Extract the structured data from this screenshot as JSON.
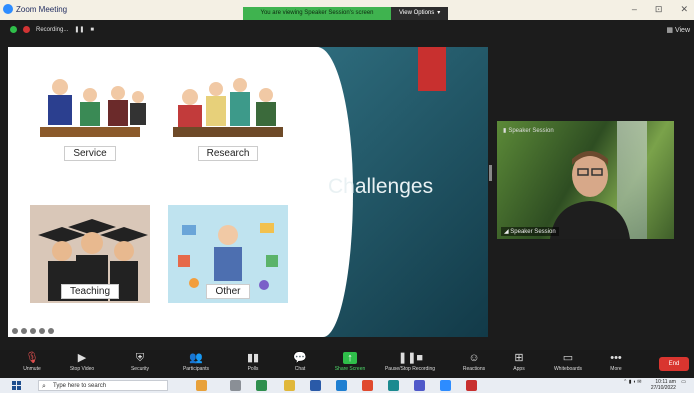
{
  "titlebar": {
    "app_name": "Zoom Meeting"
  },
  "share_banner": {
    "message": "You are viewing Speaker Session's screen",
    "options_label": "View Options"
  },
  "window_controls": {
    "minimize": "–",
    "maximize": "⊡",
    "close": "✕"
  },
  "meeting": {
    "recording_label": "Recording...",
    "view_label": "View"
  },
  "slide": {
    "title": "Challenges",
    "quadrants": [
      {
        "label": "Service"
      },
      {
        "label": "Research"
      },
      {
        "label": "Teaching"
      },
      {
        "label": "Other"
      }
    ],
    "colors": {
      "accent_red": "#c8302f",
      "panel_blue": "#1f5566"
    }
  },
  "video_tile": {
    "top_label": "Speaker Session",
    "name_label": "Speaker Session"
  },
  "toolbar": {
    "items": [
      {
        "label": "Unmute",
        "icon": "mic-muted-icon"
      },
      {
        "label": "Stop Video",
        "icon": "video-icon"
      },
      {
        "label": "Security",
        "icon": "shield-icon"
      },
      {
        "label": "Participants",
        "icon": "participants-icon",
        "count": "10"
      },
      {
        "label": "Polls",
        "icon": "polls-icon"
      },
      {
        "label": "Chat",
        "icon": "chat-icon"
      },
      {
        "label": "Share Screen",
        "icon": "share-screen-icon"
      },
      {
        "label": "Pause/Stop Recording",
        "icon": "record-icon"
      },
      {
        "label": "Reactions",
        "icon": "reactions-icon"
      },
      {
        "label": "Apps",
        "icon": "apps-icon"
      },
      {
        "label": "Whiteboards",
        "icon": "whiteboard-icon"
      },
      {
        "label": "More",
        "icon": "more-icon"
      }
    ],
    "end_label": "End",
    "end_color": "#d9352f"
  },
  "taskbar": {
    "search_placeholder": "Type here to search",
    "time": "10:11 am",
    "date": "27/10/2022"
  }
}
